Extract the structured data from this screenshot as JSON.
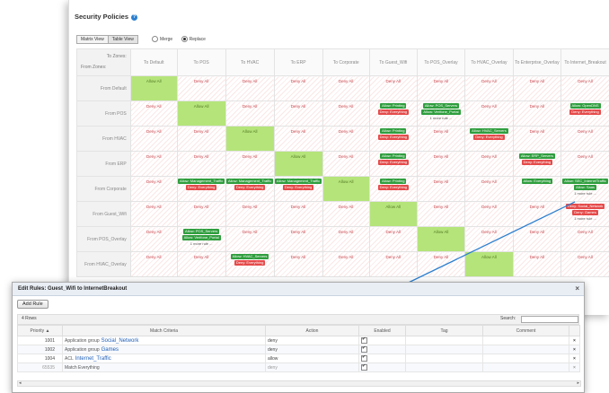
{
  "window": {
    "title": "Security Policies"
  },
  "view_tabs": [
    "Matrix View",
    "Table View"
  ],
  "modes": [
    "Merge",
    "Replace"
  ],
  "corner": {
    "to": "To Zones:",
    "from": "From Zones:"
  },
  "to_zones": [
    "To Default",
    "To POS",
    "To HVAC",
    "To ERP",
    "To Corporate",
    "To Guest_Wifi",
    "To POS_Overlay",
    "To HVAC_Overlay",
    "To Enterprise_Overlay",
    "To Internet_Breakout"
  ],
  "from_zones": [
    "From Default",
    "From POS",
    "From HVAC",
    "From ERP",
    "From Corporate",
    "From Guest_Wifi",
    "From POS_Overlay",
    "From HVAC_Overlay"
  ],
  "matrix_rows": [
    [
      {
        "t": "Allow All",
        "self": true
      },
      {
        "t": "Deny All"
      },
      {
        "t": "Deny All"
      },
      {
        "t": "Deny All"
      },
      {
        "t": "Deny All"
      },
      {
        "t": "Deny All"
      },
      {
        "t": "Deny All"
      },
      {
        "t": "Deny All"
      },
      {
        "t": "Deny All"
      },
      {
        "t": "Deny All"
      }
    ],
    [
      {
        "t": "Deny All"
      },
      {
        "t": "Allow All",
        "self": true
      },
      {
        "t": "Deny All"
      },
      {
        "t": "Deny All"
      },
      {
        "t": "Deny All"
      },
      {
        "tags": [
          [
            "g",
            "Allow: Printing"
          ],
          [
            "r",
            "Deny: Everything"
          ]
        ]
      },
      {
        "tags": [
          [
            "g",
            "Allow: POS_Servers"
          ],
          [
            "g",
            "Allow: Verifone_Portal"
          ],
          [
            "m",
            "1 more rule ..."
          ]
        ]
      },
      {
        "t": "Deny All"
      },
      {
        "t": "Deny All"
      },
      {
        "tags": [
          [
            "g",
            "Allow: OpenDNS"
          ],
          [
            "r",
            "Deny: Everything"
          ]
        ]
      }
    ],
    [
      {
        "t": "Deny All"
      },
      {
        "t": "Deny All"
      },
      {
        "t": "Allow All",
        "self": true
      },
      {
        "t": "Deny All"
      },
      {
        "t": "Deny All"
      },
      {
        "tags": [
          [
            "g",
            "Allow: Printing"
          ],
          [
            "r",
            "Deny: Everything"
          ]
        ]
      },
      {
        "t": "Deny All"
      },
      {
        "tags": [
          [
            "g",
            "Allow: HVAC_Servers"
          ],
          [
            "r",
            "Deny: Everything"
          ]
        ]
      },
      {
        "t": "Deny All"
      },
      {
        "t": "Deny All"
      }
    ],
    [
      {
        "t": "Deny All"
      },
      {
        "t": "Deny All"
      },
      {
        "t": "Deny All"
      },
      {
        "t": "Allow All",
        "self": true
      },
      {
        "t": "Deny All"
      },
      {
        "tags": [
          [
            "g",
            "Allow: Printing"
          ],
          [
            "r",
            "Deny: Everything"
          ]
        ]
      },
      {
        "t": "Deny All"
      },
      {
        "t": "Deny All"
      },
      {
        "tags": [
          [
            "g",
            "Allow: ERP_Servers"
          ],
          [
            "r",
            "Deny: Everything"
          ]
        ]
      },
      {
        "t": "Deny All"
      }
    ],
    [
      {
        "t": "Deny All"
      },
      {
        "tags": [
          [
            "g",
            "Allow: Management_Traffic"
          ],
          [
            "r",
            "Deny: Everything"
          ]
        ]
      },
      {
        "tags": [
          [
            "g",
            "Allow: Management_Traffic"
          ],
          [
            "r",
            "Deny: Everything"
          ]
        ]
      },
      {
        "tags": [
          [
            "g",
            "Allow: Management_Traffic"
          ],
          [
            "r",
            "Deny: Everything"
          ]
        ]
      },
      {
        "t": "Allow All",
        "self": true
      },
      {
        "tags": [
          [
            "g",
            "Allow: Printing"
          ],
          [
            "r",
            "Deny: Everything"
          ]
        ]
      },
      {
        "t": "Deny All"
      },
      {
        "t": "Deny All"
      },
      {
        "tags": [
          [
            "g",
            "Allow: Everything"
          ]
        ]
      },
      {
        "tags": [
          [
            "g",
            "Allow: SEC_InternetTraffic"
          ],
          [
            "g",
            "Allow: Saas"
          ],
          [
            "m",
            "1 more rule ..."
          ]
        ]
      }
    ],
    [
      {
        "t": "Deny All"
      },
      {
        "t": "Deny All"
      },
      {
        "t": "Deny All"
      },
      {
        "t": "Deny All"
      },
      {
        "t": "Deny All"
      },
      {
        "t": "Allow All",
        "self": true
      },
      {
        "t": "Deny All"
      },
      {
        "t": "Deny All"
      },
      {
        "t": "Deny All"
      },
      {
        "tags": [
          [
            "r",
            "Deny: Social_Network"
          ],
          [
            "r",
            "Deny: Games"
          ],
          [
            "m",
            "1 more rule ..."
          ]
        ]
      }
    ],
    [
      {
        "t": "Deny All"
      },
      {
        "tags": [
          [
            "g",
            "Allow: POS_Servers"
          ],
          [
            "g",
            "Allow: Verifone_Portal"
          ],
          [
            "m",
            "1 more rule ..."
          ]
        ]
      },
      {
        "t": "Deny All"
      },
      {
        "t": "Deny All"
      },
      {
        "t": "Deny All"
      },
      {
        "t": "Deny All"
      },
      {
        "t": "Allow All",
        "self": true
      },
      {
        "t": "Deny All"
      },
      {
        "t": "Deny All"
      },
      {
        "t": "Deny All"
      }
    ],
    [
      {
        "t": "Deny All"
      },
      {
        "t": "Deny All"
      },
      {
        "tags": [
          [
            "g",
            "Allow: HVAC_Servers"
          ],
          [
            "r",
            "Deny: Everything"
          ]
        ]
      },
      {
        "t": "Deny All"
      },
      {
        "t": "Deny All"
      },
      {
        "t": "Deny All"
      },
      {
        "t": "Deny All"
      },
      {
        "t": "Allow All",
        "self": true
      },
      {
        "t": "Deny All"
      },
      {
        "t": "Deny All"
      }
    ]
  ],
  "dialog": {
    "title": "Edit Rules: Guest_Wifi to InternetBreakout",
    "close": "×",
    "add_rule": "Add Rule",
    "rows_label": "4 Rows",
    "search_label": "Search:",
    "search_value": "",
    "columns": [
      "Priority ▲",
      "Match Criteria",
      "Action",
      "Enabled",
      "Tag",
      "Comment",
      ""
    ],
    "rules": [
      {
        "priority": "1001",
        "kind": "Application group",
        "name": "Social_Network",
        "action": "deny",
        "enabled": true,
        "tag": "",
        "comment": "",
        "muted": false
      },
      {
        "priority": "1002",
        "kind": "Application group",
        "name": "Games",
        "action": "deny",
        "enabled": true,
        "tag": "",
        "comment": "",
        "muted": false
      },
      {
        "priority": "1004",
        "kind": "ACL",
        "name": "Internet_Traffic",
        "action": "allow",
        "enabled": true,
        "tag": "",
        "comment": "",
        "muted": false
      },
      {
        "priority": "65535",
        "kind": "Match Everything",
        "name": "",
        "action": "deny",
        "enabled": true,
        "tag": "",
        "comment": "",
        "muted": true
      }
    ],
    "delete_icon": "×"
  },
  "colors": {
    "allow": "#2f9e3e",
    "deny": "#e54a4a",
    "self_cell": "#b5e47b",
    "arrow": "#2b7fd0"
  }
}
